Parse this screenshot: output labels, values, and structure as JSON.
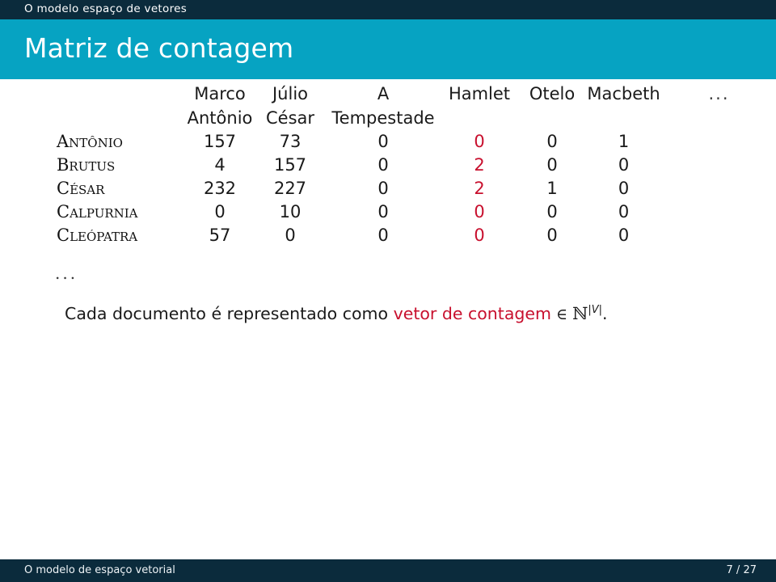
{
  "headline": {
    "text": "O modelo espaço de vetores"
  },
  "frame": {
    "title": "Matriz de contagem"
  },
  "colors": {
    "navy": "#0b2b3c",
    "cyan": "#06a3c2",
    "accent_red": "#c8102e",
    "text": "#1a1a1a",
    "background": "#ffffff"
  },
  "chart_data": {
    "type": "table",
    "title": "Matriz de contagem",
    "columns_line1": [
      "Marco",
      "Júlio",
      "A",
      "Hamlet",
      "Otelo",
      "Macbeth",
      "..."
    ],
    "columns_line2": [
      "Antônio",
      "César",
      "Tempestade",
      "",
      "",
      "",
      ""
    ],
    "columns": [
      "Marco Antônio",
      "Júlio César",
      "A Tempestade",
      "Hamlet",
      "Otelo",
      "Macbeth",
      "..."
    ],
    "rows": [
      "Antônio",
      "Brutus",
      "César",
      "Calpurnia",
      "Cleópatra",
      "..."
    ],
    "values": [
      [
        157,
        73,
        0,
        0,
        0,
        1
      ],
      [
        4,
        157,
        0,
        2,
        0,
        0
      ],
      [
        232,
        227,
        0,
        2,
        1,
        0
      ],
      [
        0,
        10,
        0,
        0,
        0,
        0
      ],
      [
        57,
        0,
        0,
        0,
        0,
        0
      ]
    ],
    "row_ellipsis": "...",
    "highlight_column_index": 3,
    "highlight_color": "#c8102e",
    "note": "Column 'Hamlet' (index 3) is rendered in red to highlight the count vector of one document."
  },
  "table": {
    "header_row1": [
      {
        "label": "Marco"
      },
      {
        "label": "Júlio"
      },
      {
        "label": "A"
      },
      {
        "label": "Hamlet"
      },
      {
        "label": "Otelo"
      },
      {
        "label": "Macbeth"
      },
      {
        "label": "..."
      }
    ],
    "header_row2": [
      {
        "label": "Antônio"
      },
      {
        "label": "César"
      },
      {
        "label": "Tempestade"
      },
      {
        "label": ""
      },
      {
        "label": ""
      },
      {
        "label": ""
      },
      {
        "label": ""
      }
    ],
    "body_rows": [
      {
        "label": "Antônio",
        "cells": [
          "157",
          "73",
          "0",
          "0",
          "0",
          "1"
        ]
      },
      {
        "label": "Brutus",
        "cells": [
          "4",
          "157",
          "0",
          "2",
          "0",
          "0"
        ]
      },
      {
        "label": "César",
        "cells": [
          "232",
          "227",
          "0",
          "2",
          "1",
          "0"
        ]
      },
      {
        "label": "Calpurnia",
        "cells": [
          "0",
          "10",
          "0",
          "0",
          "0",
          "0"
        ]
      },
      {
        "label": "Cleópatra",
        "cells": [
          "57",
          "0",
          "0",
          "0",
          "0",
          "0"
        ]
      }
    ],
    "row_ellipsis": "..."
  },
  "caption": {
    "part1": "Cada documento é representado como ",
    "accent": "vetor de contagem",
    "in_symbol": " ∈ ",
    "set_symbol": "ℕ",
    "superscript": "|V|",
    "period": "."
  },
  "footer": {
    "left": "O modelo de espaço vetorial",
    "right": "7 / 27"
  }
}
